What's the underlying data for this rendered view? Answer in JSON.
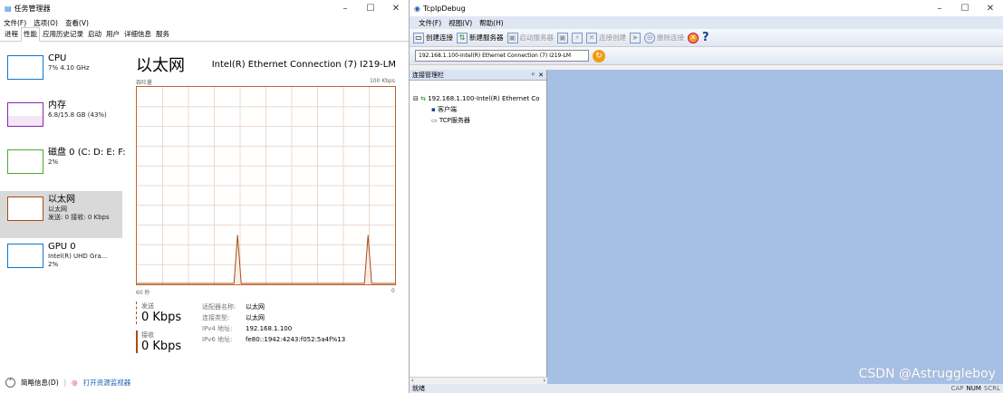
{
  "taskmgr": {
    "title": "任务管理器",
    "menu": [
      "文件(F)",
      "选项(O)",
      "查看(V)"
    ],
    "tabs": [
      "进程",
      "性能",
      "应用历史记录",
      "启动",
      "用户",
      "详细信息",
      "服务"
    ],
    "active_tab": "性能",
    "sidebar": [
      {
        "name": "CPU",
        "sub1": "7% 4.10 GHz",
        "sub2": "",
        "color": "#1174d0"
      },
      {
        "name": "内存",
        "sub1": "6.8/15.8 GB (43%)",
        "sub2": "",
        "color": "#8e26ad"
      },
      {
        "name": "磁盘 0 (C: D: E: F:",
        "sub1": "2%",
        "sub2": "",
        "color": "#4ea72e"
      },
      {
        "name": "以太网",
        "sub1": "以太网",
        "sub2": "发送: 0 接收: 0 Kbps",
        "color": "#a74c15"
      },
      {
        "name": "GPU 0",
        "sub1": "Intel(R) UHD Gra...",
        "sub2": "2%",
        "color": "#1174d0"
      }
    ],
    "main": {
      "title": "以太网",
      "adapter": "Intel(R) Ethernet Connection (7) I219-LM",
      "throughput": "吞吐量",
      "max": "100 Kbps",
      "time": "60 秒",
      "zero": "0"
    },
    "stats": {
      "send_label": "发送",
      "send_val": "0 Kbps",
      "recv_label": "接收",
      "recv_val": "0 Kbps"
    },
    "details": [
      [
        "适配器名称:",
        "以太网"
      ],
      [
        "连接类型:",
        "以太网"
      ],
      [
        "IPv4 地址:",
        "192.168.1.100"
      ],
      [
        "IPv6 地址:",
        "fe80::1942:4243:f052:5a4f%13"
      ]
    ],
    "footer": {
      "brief": "简略信息(D)",
      "monitor": "打开资源监视器"
    }
  },
  "tcp": {
    "title": "TcpIpDebug",
    "menu": [
      "文件(F)",
      "视图(V)",
      "帮助(H)"
    ],
    "toolbar": {
      "create_conn": "创建连接",
      "create_server": "新建服务器",
      "start_server": "启动服务器",
      "conn_create": "连接创建",
      "delete_conn": "删除连接"
    },
    "select": "192.168.1.100-Intel(R) Ethernet Connection (7) I219-LM",
    "panel_title": "连接管理栏",
    "tree": {
      "root": "192.168.1.100-Intel(R) Ethernet Co",
      "client": "客户端",
      "server": "TCP服务器"
    },
    "status": "就绪",
    "status_right": [
      "CAP",
      "NUM",
      "SCRL"
    ]
  },
  "watermark": "CSDN @Astruggleboy"
}
